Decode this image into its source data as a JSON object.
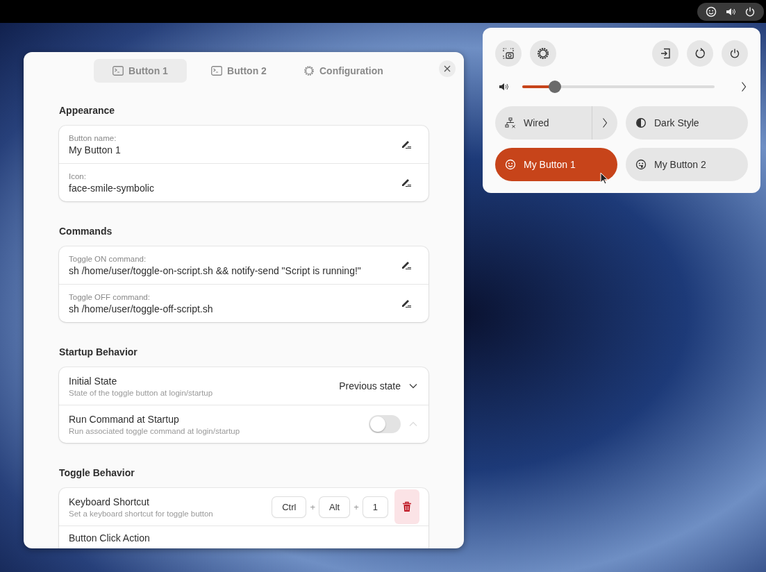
{
  "top_bar": {
    "indicators": [
      {
        "kind": "smiley"
      },
      {
        "kind": "volume"
      },
      {
        "kind": "power"
      }
    ]
  },
  "dialog": {
    "tabs": [
      {
        "label": "Button 1",
        "selected": true
      },
      {
        "label": "Button 2",
        "selected": false
      },
      {
        "label": "Configuration",
        "selected": false
      }
    ],
    "sections": [
      {
        "title": "Appearance",
        "rows": [
          {
            "kind": "entry",
            "label": "Button name:",
            "value": "My Button 1"
          },
          {
            "kind": "entry",
            "label": "Icon:",
            "value": "face-smile-symbolic"
          }
        ]
      },
      {
        "title": "Commands",
        "rows": [
          {
            "kind": "entry",
            "label": "Toggle ON command:",
            "value": "sh /home/user/toggle-on-script.sh && notify-send \"Script is running!\""
          },
          {
            "kind": "entry",
            "label": "Toggle OFF command:",
            "value": "sh /home/user/toggle-off-script.sh"
          }
        ]
      },
      {
        "title": "Startup Behavior",
        "rows": [
          {
            "kind": "dropdown",
            "title": "Initial State",
            "subtitle": "State of the toggle button at login/startup",
            "value": "Previous state"
          },
          {
            "kind": "switch",
            "title": "Run Command at Startup",
            "subtitle": "Run associated toggle command at login/startup",
            "on": false
          }
        ]
      },
      {
        "title": "Toggle Behavior",
        "rows": [
          {
            "kind": "shortcut",
            "title": "Keyboard Shortcut",
            "subtitle": "Set a keyboard shortcut for toggle button",
            "keys": [
              "Ctrl",
              "Alt",
              "1"
            ],
            "separator": "+"
          },
          {
            "kind": "plain",
            "title": "Button Click Action"
          }
        ]
      }
    ]
  },
  "quick_settings": {
    "volume": {
      "level": 0.17
    },
    "toggles": [
      {
        "label": "Wired",
        "kind": "split",
        "selected": false
      },
      {
        "label": "Dark Style",
        "kind": "plain",
        "selected": false
      },
      {
        "label": "My Button 1",
        "kind": "plain",
        "selected": true
      },
      {
        "label": "My Button 2",
        "kind": "plain",
        "selected": false
      }
    ]
  }
}
